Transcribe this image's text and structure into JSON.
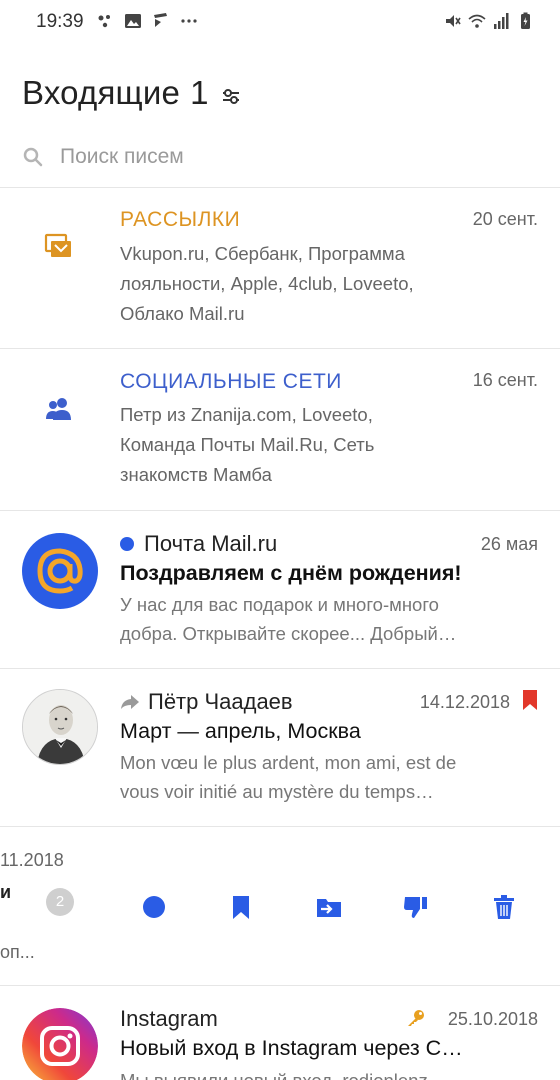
{
  "status_bar": {
    "time": "19:39",
    "left_icons": [
      "assistant-icon",
      "gallery-icon",
      "clapper-icon",
      "more-dots-icon"
    ],
    "right_icons": [
      "mute-icon",
      "wifi-icon",
      "signal-icon",
      "battery-icon"
    ]
  },
  "header": {
    "title": "Входящие",
    "count": "1",
    "filter_icon": "filter-icon"
  },
  "search": {
    "placeholder": "Поиск писем"
  },
  "colors": {
    "accent_blue": "#2a5ce5",
    "newsletter_orange": "#dd9422",
    "social_blue": "#3d5fcc",
    "flag_red": "#e2372a",
    "key_yellow": "#e8a020"
  },
  "categories": [
    {
      "title": "РАССЫЛКИ",
      "date": "20 сент.",
      "icon": "newsletter-icon",
      "preview": "Vkupon.ru, Сбербанк, Программа лояльности, Apple, 4club, Loveeto, Облако Mail.ru"
    },
    {
      "title": "СОЦИАЛЬНЫЕ СЕТИ",
      "date": "16 сент.",
      "icon": "people-icon",
      "preview": "Петр из Znanija.com, Loveeto, Команда Почты Mail.Ru, Сеть знакомств Мамба"
    }
  ],
  "messages": [
    {
      "sender": "Почта Mail.ru",
      "date": "26 мая",
      "subject": "Поздравляем с днём рождения!",
      "preview": "У нас для вас подарок и много-много добра. Открывайте скорее... Добрый…",
      "unread": true
    },
    {
      "sender": "Пётр Чаадаев",
      "date": "14.12.2018",
      "subject": "Март — апрель, Москва",
      "preview": "Mon vœu le plus ardent, mon ami, est de vous voir initié au mystère du temps…",
      "forwarded": true,
      "flagged": true
    },
    {
      "sender": "Instagram",
      "date": "25.10.2018",
      "subject": "Новый вход в Instagram через С…",
      "preview": "Мы выявили новый вход, rodionlenz",
      "important": true
    }
  ],
  "swiped_row": {
    "date_fragment": "11.2018",
    "text_fragment_1": "и",
    "text_fragment_2": "оп...",
    "thread_count": "2",
    "actions": [
      "mark-unread-icon",
      "bookmark-icon",
      "move-to-folder-icon",
      "spam-icon",
      "delete-icon"
    ]
  }
}
